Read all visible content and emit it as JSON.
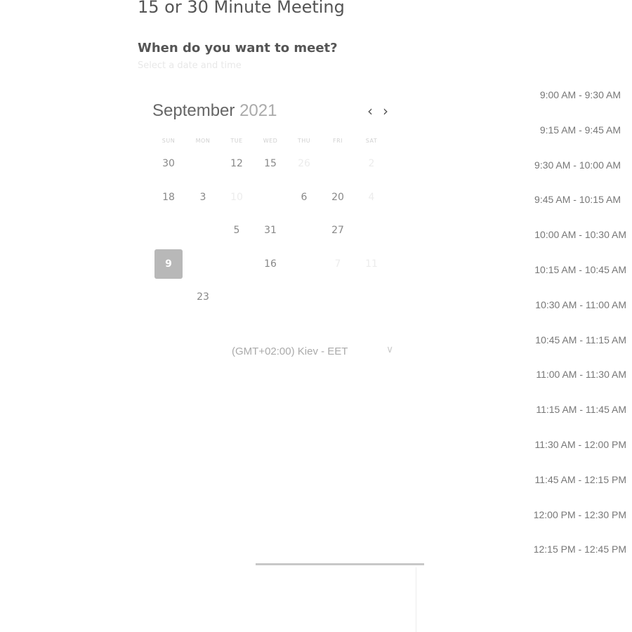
{
  "header": {
    "title": "15 or 30 Minute Meeting",
    "question": "When do you want to meet?",
    "subtitle": "Select a date and time"
  },
  "calendar": {
    "month": "September",
    "year": "2021",
    "prev_icon": "chevron-left-icon",
    "next_icon": "chevron-right-icon",
    "weekdays": [
      "SUN",
      "MON",
      "TUE",
      "WED",
      "THU",
      "FRI",
      "SAT"
    ],
    "days": [
      {
        "label": "30",
        "row": 0,
        "col": 0,
        "state": "normal"
      },
      {
        "label": "12",
        "row": 0,
        "col": 2,
        "state": "normal"
      },
      {
        "label": "15",
        "row": 0,
        "col": 3,
        "state": "normal"
      },
      {
        "label": "26",
        "row": 0,
        "col": 4,
        "state": "faint"
      },
      {
        "label": "2",
        "row": 0,
        "col": 6,
        "state": "faint"
      },
      {
        "label": "18",
        "row": 1,
        "col": 0,
        "state": "normal"
      },
      {
        "label": "3",
        "row": 1,
        "col": 1,
        "state": "normal"
      },
      {
        "label": "10",
        "row": 1,
        "col": 2,
        "state": "faint"
      },
      {
        "label": "6",
        "row": 1,
        "col": 4,
        "state": "normal"
      },
      {
        "label": "20",
        "row": 1,
        "col": 5,
        "state": "normal"
      },
      {
        "label": "4",
        "row": 1,
        "col": 6,
        "state": "faint"
      },
      {
        "label": "5",
        "row": 2,
        "col": 2,
        "state": "normal"
      },
      {
        "label": "31",
        "row": 2,
        "col": 3,
        "state": "normal"
      },
      {
        "label": "27",
        "row": 2,
        "col": 5,
        "state": "normal"
      },
      {
        "label": "9",
        "row": 3,
        "col": 0,
        "state": "selected"
      },
      {
        "label": "16",
        "row": 3,
        "col": 3,
        "state": "normal"
      },
      {
        "label": "7",
        "row": 3,
        "col": 5,
        "state": "faint"
      },
      {
        "label": "11",
        "row": 3,
        "col": 6,
        "state": "faint"
      },
      {
        "label": "23",
        "row": 4,
        "col": 1,
        "state": "normal"
      }
    ]
  },
  "timezone": {
    "label": "(GMT+02:00) Kiev - EET",
    "icon": "chevron-down-icon"
  },
  "time_slots": [
    "9:00 AM - 9:30 AM",
    "9:15 AM - 9:45 AM",
    "9:30 AM - 10:00 AM",
    "9:45 AM - 10:15 AM",
    "10:00 AM - 10:30 AM",
    "10:15 AM - 10:45 AM",
    "10:30 AM - 11:00 AM",
    "10:45 AM - 11:15 AM",
    "11:00 AM - 11:30 AM",
    "11:15 AM - 11:45 AM",
    "11:30 AM - 12:00 PM",
    "11:45 AM - 12:15 PM",
    "12:00 PM - 12:30 PM",
    "12:15 PM - 12:45 PM"
  ],
  "colors": {
    "selected_day_bg": "#b8b8b8",
    "text": "#555555"
  }
}
